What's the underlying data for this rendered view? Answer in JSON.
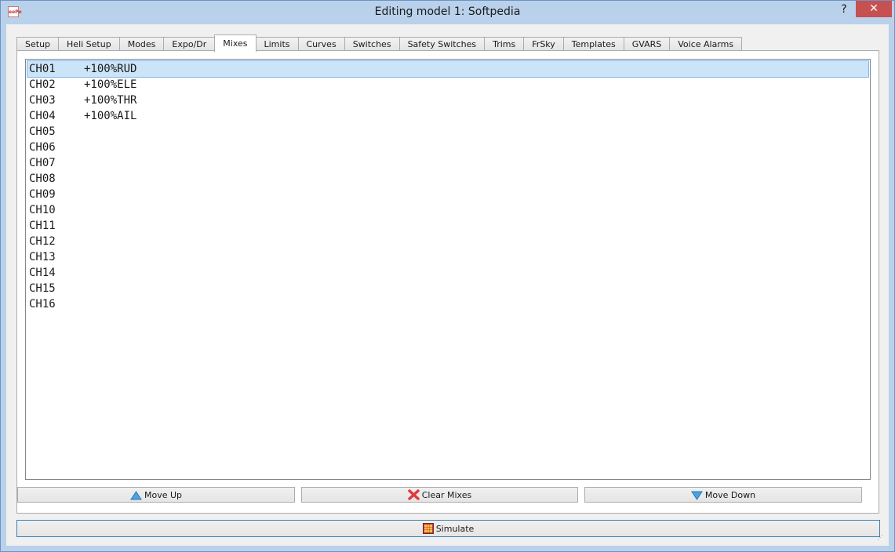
{
  "window": {
    "title": "Editing model 1: Softpedia",
    "help_label": "?",
    "close_label": "✕",
    "app_icon_text": "eePe"
  },
  "tabs": [
    {
      "label": "Setup"
    },
    {
      "label": "Heli Setup"
    },
    {
      "label": "Modes"
    },
    {
      "label": "Expo/Dr"
    },
    {
      "label": "Mixes",
      "active": true
    },
    {
      "label": "Limits"
    },
    {
      "label": "Curves"
    },
    {
      "label": "Switches"
    },
    {
      "label": "Safety Switches"
    },
    {
      "label": "Trims"
    },
    {
      "label": "FrSky"
    },
    {
      "label": "Templates"
    },
    {
      "label": "GVARS"
    },
    {
      "label": "Voice Alarms"
    }
  ],
  "mixes": [
    {
      "channel": "CH01",
      "mix": "+100%RUD",
      "selected": true
    },
    {
      "channel": "CH02",
      "mix": "+100%ELE"
    },
    {
      "channel": "CH03",
      "mix": "+100%THR"
    },
    {
      "channel": "CH04",
      "mix": "+100%AIL"
    },
    {
      "channel": "CH05",
      "mix": ""
    },
    {
      "channel": "CH06",
      "mix": ""
    },
    {
      "channel": "CH07",
      "mix": ""
    },
    {
      "channel": "CH08",
      "mix": ""
    },
    {
      "channel": "CH09",
      "mix": ""
    },
    {
      "channel": "CH10",
      "mix": ""
    },
    {
      "channel": "CH11",
      "mix": ""
    },
    {
      "channel": "CH12",
      "mix": ""
    },
    {
      "channel": "CH13",
      "mix": ""
    },
    {
      "channel": "CH14",
      "mix": ""
    },
    {
      "channel": "CH15",
      "mix": ""
    },
    {
      "channel": "CH16",
      "mix": ""
    }
  ],
  "buttons": {
    "move_up": "Move Up",
    "clear_mixes": "Clear Mixes",
    "move_down": "Move Down",
    "simulate": "Simulate"
  },
  "colors": {
    "selection": "#cce4f7",
    "close": "#c75050",
    "move_icon": "#4aa3df",
    "clear_icon": "#e03a3a"
  },
  "icons": {
    "move_up": "triangle-up-icon",
    "clear_mixes": "red-x-icon",
    "move_down": "triangle-down-icon",
    "simulate": "grid-icon"
  }
}
